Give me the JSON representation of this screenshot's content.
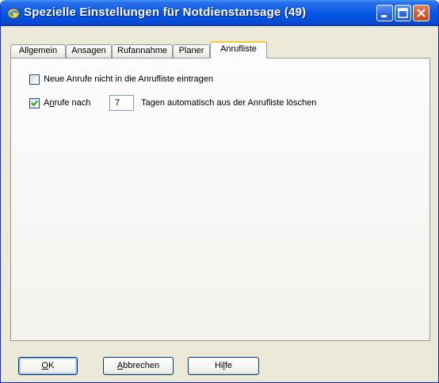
{
  "window": {
    "title": "Spezielle Einstellungen für Notdienstansage (49)",
    "titlebar_color": "#0054e3",
    "buttons": [
      "minimize-icon",
      "maximize-icon",
      "close-icon"
    ]
  },
  "tabs": [
    {
      "label": "Allgemein",
      "active": false
    },
    {
      "label": "Ansagen",
      "active": false
    },
    {
      "label": "Rufannahme",
      "active": false
    },
    {
      "label": "Planer",
      "active": false
    },
    {
      "label": "Anrufliste",
      "active": true
    }
  ],
  "options": {
    "no_log": {
      "label": "Neue Anrufe nicht in die Anrufliste eintragen",
      "checked": false
    },
    "auto_delete": {
      "label_before_mnemonic": "A",
      "label_mnemonic": "n",
      "label_after_mnemonic": "rufe nach",
      "checked": true,
      "days_value": "7",
      "label_after": "Tagen automatisch aus der Anrufliste löschen"
    }
  },
  "buttons": {
    "ok": {
      "mnemonic": "O",
      "rest": "K"
    },
    "cancel": {
      "mnemonic": "A",
      "rest": "bbrechen"
    },
    "help": {
      "before": "Hi",
      "mnemonic": "l",
      "after": "fe"
    }
  }
}
